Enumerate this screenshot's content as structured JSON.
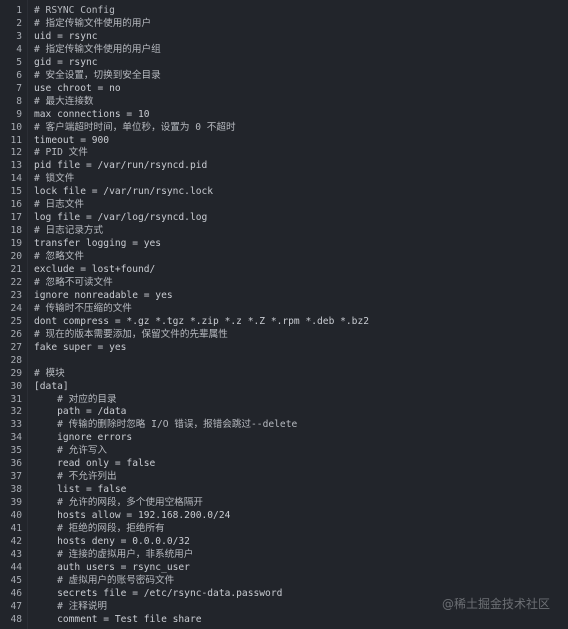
{
  "editor": {
    "lines": [
      {
        "n": "1",
        "text": "# RSYNC Config",
        "comment": true
      },
      {
        "n": "2",
        "text": "# 指定传输文件使用的用户",
        "comment": true
      },
      {
        "n": "3",
        "text": "uid = rsync",
        "comment": false
      },
      {
        "n": "4",
        "text": "# 指定传输文件使用的用户组",
        "comment": true
      },
      {
        "n": "5",
        "text": "gid = rsync",
        "comment": false
      },
      {
        "n": "6",
        "text": "# 安全设置，切换到安全目录",
        "comment": true
      },
      {
        "n": "7",
        "text": "use chroot = no",
        "comment": false
      },
      {
        "n": "8",
        "text": "# 最大连接数",
        "comment": true
      },
      {
        "n": "9",
        "text": "max connections = 10",
        "comment": false
      },
      {
        "n": "10",
        "text": "# 客户端超时时间，单位秒，设置为 0 不超时",
        "comment": true
      },
      {
        "n": "11",
        "text": "timeout = 900",
        "comment": false
      },
      {
        "n": "12",
        "text": "# PID 文件",
        "comment": true
      },
      {
        "n": "13",
        "text": "pid file = /var/run/rsyncd.pid",
        "comment": false
      },
      {
        "n": "14",
        "text": "# 锁文件",
        "comment": true
      },
      {
        "n": "15",
        "text": "lock file = /var/run/rsync.lock",
        "comment": false
      },
      {
        "n": "16",
        "text": "# 日志文件",
        "comment": true
      },
      {
        "n": "17",
        "text": "log file = /var/log/rsyncd.log",
        "comment": false
      },
      {
        "n": "18",
        "text": "# 日志记录方式",
        "comment": true
      },
      {
        "n": "19",
        "text": "transfer logging = yes",
        "comment": false
      },
      {
        "n": "20",
        "text": "# 忽略文件",
        "comment": true
      },
      {
        "n": "21",
        "text": "exclude = lost+found/",
        "comment": false
      },
      {
        "n": "22",
        "text": "# 忽略不可读文件",
        "comment": true
      },
      {
        "n": "23",
        "text": "ignore nonreadable = yes",
        "comment": false
      },
      {
        "n": "24",
        "text": "# 传输时不压缩的文件",
        "comment": true
      },
      {
        "n": "25",
        "text": "dont compress = *.gz *.tgz *.zip *.z *.Z *.rpm *.deb *.bz2",
        "comment": false
      },
      {
        "n": "26",
        "text": "# 现在的版本需要添加，保留文件的先辈属性",
        "comment": true
      },
      {
        "n": "27",
        "text": "fake super = yes",
        "comment": false
      },
      {
        "n": "28",
        "text": "",
        "comment": false
      },
      {
        "n": "29",
        "text": "# 模块",
        "comment": true
      },
      {
        "n": "30",
        "text": "[data]",
        "comment": false
      },
      {
        "n": "31",
        "text": "    # 对应的目录",
        "comment": true
      },
      {
        "n": "32",
        "text": "    path = /data",
        "comment": false
      },
      {
        "n": "33",
        "text": "    # 传输的删除时忽略 I/O 错误，报错会跳过--delete",
        "comment": true
      },
      {
        "n": "34",
        "text": "    ignore errors",
        "comment": false
      },
      {
        "n": "35",
        "text": "    # 允许写入",
        "comment": true
      },
      {
        "n": "36",
        "text": "    read only = false",
        "comment": false
      },
      {
        "n": "37",
        "text": "    # 不允许列出",
        "comment": true
      },
      {
        "n": "38",
        "text": "    list = false",
        "comment": false
      },
      {
        "n": "39",
        "text": "    # 允许的网段，多个使用空格隔开",
        "comment": true
      },
      {
        "n": "40",
        "text": "    hosts allow = 192.168.200.0/24",
        "comment": false
      },
      {
        "n": "41",
        "text": "    # 拒绝的网段，拒绝所有",
        "comment": true
      },
      {
        "n": "42",
        "text": "    hosts deny = 0.0.0.0/32",
        "comment": false
      },
      {
        "n": "43",
        "text": "    # 连接的虚拟用户，非系统用户",
        "comment": true
      },
      {
        "n": "44",
        "text": "    auth users = rsync_user",
        "comment": false
      },
      {
        "n": "45",
        "text": "    # 虚拟用户的账号密码文件",
        "comment": true
      },
      {
        "n": "46",
        "text": "    secrets file = /etc/rsync-data.password",
        "comment": false
      },
      {
        "n": "47",
        "text": "    # 注释说明",
        "comment": true
      },
      {
        "n": "48",
        "text": "    comment = Test file share",
        "comment": false
      }
    ]
  },
  "watermark": {
    "text": "@稀土掘金技术社区"
  },
  "colors": {
    "background": "#22252b",
    "line_number": "#a8acb3",
    "code_text": "#c9ccd2",
    "watermark": "#6c6f74"
  }
}
